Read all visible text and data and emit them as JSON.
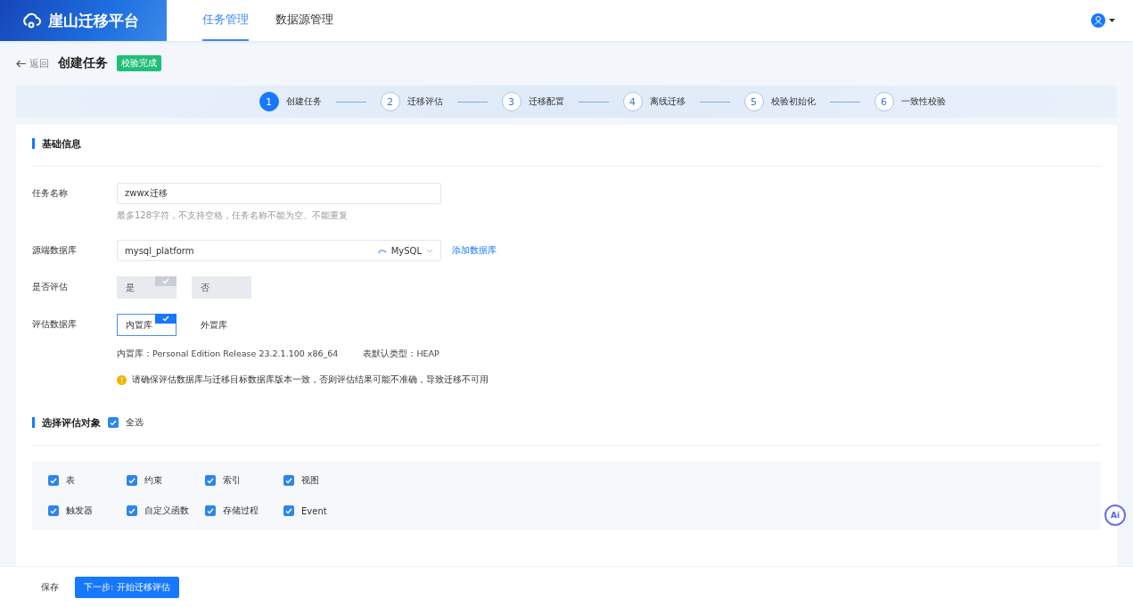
{
  "header": {
    "brand": "崖山迁移平台",
    "nav": [
      {
        "label": "任务管理",
        "selected": true
      },
      {
        "label": "数据源管理",
        "selected": false
      }
    ]
  },
  "page": {
    "back": "返回",
    "title": "创建任务",
    "status": "校验完成"
  },
  "steps": [
    {
      "number": "1",
      "label": "创建任务",
      "active": true
    },
    {
      "number": "2",
      "label": "迁移评估",
      "active": false
    },
    {
      "number": "3",
      "label": "迁移配置",
      "active": false
    },
    {
      "number": "4",
      "label": "离线迁移",
      "active": false
    },
    {
      "number": "5",
      "label": "校验初始化",
      "active": false
    },
    {
      "number": "6",
      "label": "一致性校验",
      "active": false
    }
  ],
  "basic": {
    "title": "基础信息",
    "task_name": {
      "label": "任务名称",
      "value": "zwwx迁移",
      "hint": "最多128字符，不支持空格，任务名称不能为空、不能重复"
    },
    "source_db": {
      "label": "源端数据库",
      "value": "mysql_platform",
      "type": "MySQL",
      "add_link": "添加数据库"
    },
    "evaluate": {
      "label": "是否评估",
      "disabled": true,
      "options": [
        {
          "label": "是",
          "selected": true
        },
        {
          "label": "否",
          "selected": false
        }
      ]
    },
    "eval_db": {
      "label": "评估数据库",
      "disabled": false,
      "options": [
        {
          "label": "内置库",
          "selected": true
        },
        {
          "label": "外置库",
          "selected": false
        }
      ]
    },
    "info": [
      {
        "text": "内置库：Personal Edition Release 23.2.1.100 x86_64"
      },
      {
        "text": "表默认类型：HEAP"
      }
    ],
    "warning": "请确保评估数据库与迁移目标数据库版本一致，否则评估结果可能不准确，导致迁移不可用"
  },
  "objects": {
    "title": "选择评估对象",
    "select_all": {
      "label": "全选",
      "checked": true
    },
    "items": [
      {
        "label": "表",
        "checked": true
      },
      {
        "label": "约束",
        "checked": true
      },
      {
        "label": "索引",
        "checked": true
      },
      {
        "label": "视图",
        "checked": true
      },
      {
        "label": "触发器",
        "checked": true
      },
      {
        "label": "自定义函数",
        "checked": true
      },
      {
        "label": "存储过程",
        "checked": true
      },
      {
        "label": "Event",
        "checked": true
      }
    ]
  },
  "footer": {
    "buttons": [
      {
        "label": "保存",
        "kind": "secondary"
      },
      {
        "label": "下一步: 开始迁移评估",
        "kind": "primary"
      }
    ]
  },
  "assistant": {
    "label": "Ai"
  }
}
